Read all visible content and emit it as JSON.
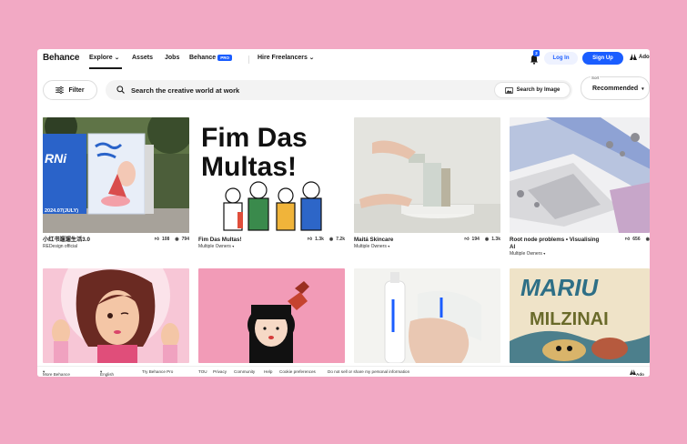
{
  "nav": {
    "logo": "Behance",
    "explore": "Explore",
    "assets": "Assets",
    "jobs": "Jobs",
    "behance_pro": "Behance",
    "pro_badge": "PRO",
    "hire": "Hire Freelancers",
    "notification_count": "2",
    "login": "Log In",
    "signup": "Sign Up",
    "adobe": "Ado"
  },
  "search": {
    "filter_label": "Filter",
    "placeholder": "Search the creative world at work",
    "image_search": "Search by Image",
    "sort_label": "Sort",
    "sort_value": "Recommended"
  },
  "projects": [
    {
      "title": "小红书遛遛生活3.0",
      "owner": "REDesign official",
      "likes": "108",
      "views": "794"
    },
    {
      "title": "Fim Das Multas!",
      "owner": "Multiple Owners",
      "likes": "1.3k",
      "views": "7.2k"
    },
    {
      "title": "Maitá Skincare",
      "owner": "Multiple Owners",
      "likes": "194",
      "views": "1.3k"
    },
    {
      "title": "Root node problems • Visualising",
      "title2": "AI",
      "owner": "Multiple Owners",
      "likes": "656",
      "views": ""
    },
    {
      "title": "",
      "owner": "",
      "likes": "",
      "views": ""
    },
    {
      "title": "",
      "owner": "",
      "likes": "",
      "views": ""
    },
    {
      "title": "",
      "owner": "",
      "likes": "",
      "views": ""
    },
    {
      "title": "",
      "owner": "",
      "likes": "",
      "views": ""
    }
  ],
  "artwork_text": {
    "poster_year": "2024.07(JULY)",
    "poster_side": "RNi",
    "multas_line1": "Fim Das",
    "multas_line2": "Multas!",
    "mariu_line1": "MARIU",
    "mariu_line2": "MILZINAI"
  },
  "footer": {
    "more": "More Behance",
    "language": "English",
    "try_pro": "Try Behance Pro",
    "tou": "TOU",
    "privacy": "Privacy",
    "community": "Community",
    "help": "Help",
    "cookies": "Cookie preferences",
    "donotsell": "Do not sell or share my personal information",
    "adobe": "Ado"
  },
  "colors": {
    "background": "#f2a9c4",
    "accent": "#1a5dff"
  }
}
